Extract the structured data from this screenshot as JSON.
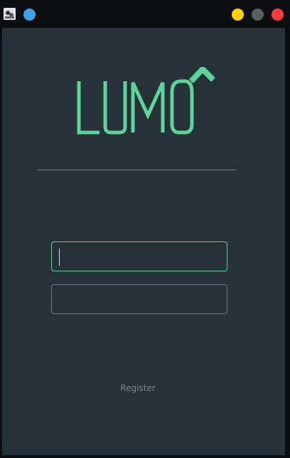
{
  "titlebar": {
    "app_icon": "app-icon",
    "status_dot": "blue-dot-icon",
    "buttons": {
      "minimize_color": "#ffd000",
      "maximize_color": "#5b5d62",
      "close_color": "#ff3b3b"
    }
  },
  "logo": {
    "text": "LUMO",
    "accent_color": "#5ed39a"
  },
  "login": {
    "username_value": "",
    "password_value": "",
    "register_label": "Register"
  },
  "colors": {
    "background": "#263238",
    "accent": "#5ed39a"
  }
}
